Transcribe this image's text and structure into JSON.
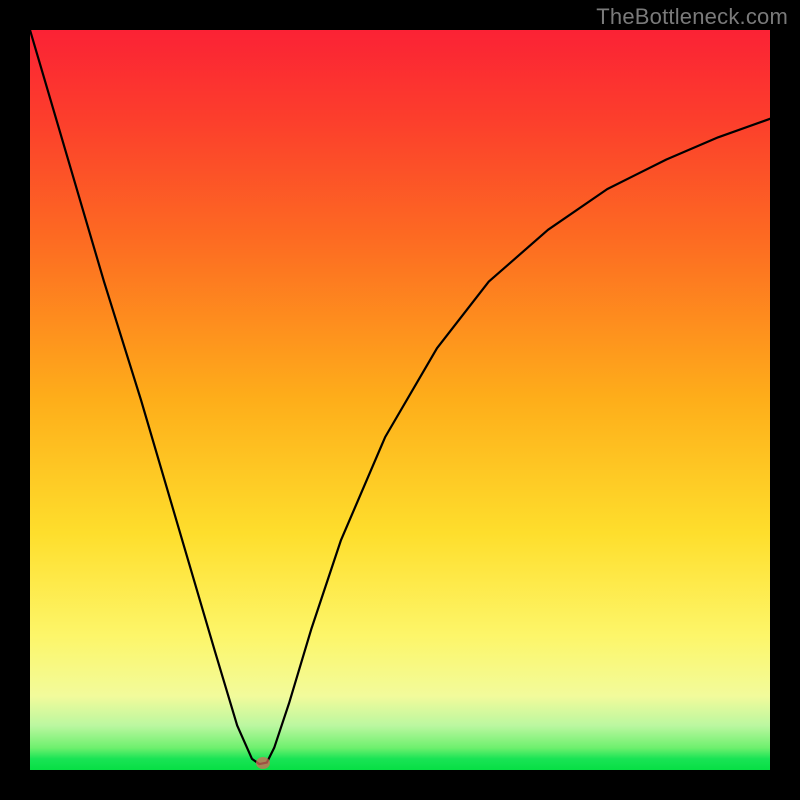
{
  "watermark": "TheBottleneck.com",
  "chart_data": {
    "type": "line",
    "title": "",
    "xlabel": "",
    "ylabel": "",
    "xlim": [
      0,
      100
    ],
    "ylim": [
      0,
      100
    ],
    "grid": false,
    "legend": false,
    "background_gradient": {
      "top_color": "#fb2235",
      "mid_color": "#fede2c",
      "bottom_color": "#07df44"
    },
    "series": [
      {
        "name": "curve",
        "color": "#000000",
        "x": [
          0,
          5,
          10,
          15,
          20,
          25,
          28,
          30,
          31,
          32,
          33,
          35,
          38,
          42,
          48,
          55,
          62,
          70,
          78,
          86,
          93,
          100
        ],
        "values": [
          100,
          83,
          66,
          50,
          33,
          16,
          6,
          1.5,
          0.8,
          1.0,
          3,
          9,
          19,
          31,
          45,
          57,
          66,
          73,
          78.5,
          82.5,
          85.5,
          88
        ]
      }
    ],
    "marker": {
      "x": 31.5,
      "y": 1.0,
      "color": "#d66a5a"
    }
  }
}
